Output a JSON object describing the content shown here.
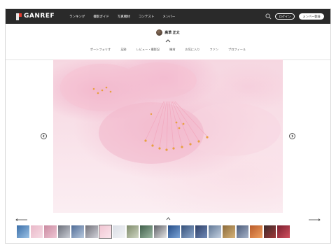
{
  "brand": {
    "name": "GANREF"
  },
  "nav": {
    "links": [
      "ランキング",
      "撮影ガイド",
      "写真機材",
      "コンテスト",
      "メンバー"
    ],
    "login_label": "ログイン",
    "register_label": "メンバー登録"
  },
  "profile": {
    "user_name": "高草 正太",
    "tabs": [
      "ポートフォリオ",
      "足跡",
      "レビュー・撮影記",
      "機材",
      "お気に入り",
      "ファン",
      "プロフィール"
    ]
  },
  "viewer": {
    "prev_label": "‹",
    "next_label": "›"
  },
  "thumbnails": {
    "active_index": 6,
    "colors": [
      [
        "#3a6ea8",
        "#9bc2e6"
      ],
      [
        "#e9b8c8",
        "#f6dbe4"
      ],
      [
        "#c98aa0",
        "#efc6d4"
      ],
      [
        "#6b6f7a",
        "#c9ccd4"
      ],
      [
        "#4e6b96",
        "#b9c9de"
      ],
      [
        "#707078",
        "#d0d0d8"
      ],
      [
        "#f0c4d2",
        "#fae6ec"
      ],
      [
        "#d9dde4",
        "#f3f4f6"
      ],
      [
        "#7d8a6a",
        "#cfd6c2"
      ],
      [
        "#3f5e4a",
        "#9db8a3"
      ],
      [
        "#5d5f66",
        "#e6e6e6"
      ],
      [
        "#254c86",
        "#7aa3d6"
      ],
      [
        "#34507a",
        "#8ea9cc"
      ],
      [
        "#2d3f66",
        "#6f89b7"
      ],
      [
        "#5f7796",
        "#c3d0e0"
      ],
      [
        "#8a6a3a",
        "#d8b47a"
      ],
      [
        "#4a5a78",
        "#a6b3c9"
      ],
      [
        "#b85a2a",
        "#f0a060"
      ],
      [
        "#3a2a2a",
        "#a03838"
      ],
      [
        "#7a1f2e",
        "#d0505e"
      ]
    ]
  }
}
